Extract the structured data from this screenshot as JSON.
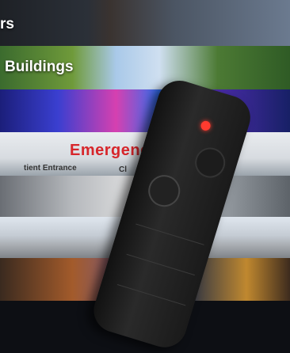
{
  "rows": [
    {
      "label": "rs"
    },
    {
      "label": "Buildings"
    }
  ],
  "signs": {
    "emergency": "Emergency",
    "entrance": "tient Entrance",
    "other": "Cl"
  },
  "colors": {
    "label_text": "#ffffff",
    "emergency_red": "#d7262b",
    "radio_led": "#ff3b2f"
  }
}
